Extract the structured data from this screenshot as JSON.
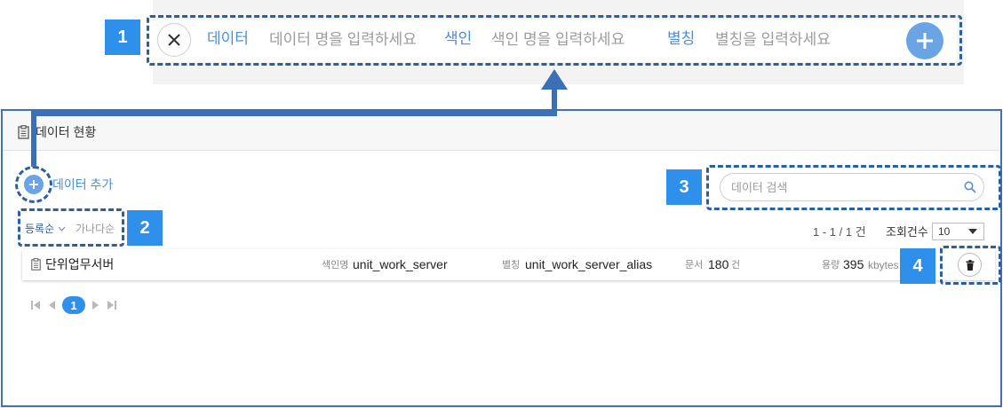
{
  "top_bar": {
    "fields": {
      "data": {
        "label": "데이터",
        "placeholder": "데이터 명을 입력하세요"
      },
      "index": {
        "label": "색인",
        "placeholder": "색인 명을 입력하세요"
      },
      "alias": {
        "label": "별칭",
        "placeholder": "별칭을 입력하세요"
      }
    },
    "icons": {
      "close": "close-icon",
      "add": "plus-icon"
    }
  },
  "callouts": {
    "c1": "1",
    "c2": "2",
    "c3": "3",
    "c4": "4"
  },
  "panel": {
    "title": "데이터 현황",
    "title_icon": "clipboard-icon",
    "add_label": "데이터 추가",
    "add_icon": "plus-icon",
    "search": {
      "placeholder": "데이터 검색",
      "icon": "search-icon"
    },
    "sort": {
      "selected": "등록순",
      "selected_icon": "chevron-down-icon",
      "other": "가나다순"
    },
    "result_range": "1 - 1 / 1 건",
    "page_size": {
      "label": "조회건수",
      "value": "10",
      "icon": "caret-down-icon"
    },
    "rows": [
      {
        "icon": "clipboard-icon",
        "name": "단위업무서버",
        "index_label": "색인명",
        "index_value": "unit_work_server",
        "alias_label": "별칭",
        "alias_value": "unit_work_server_alias",
        "doc_label": "문서",
        "doc_value": "180",
        "doc_unit": "건",
        "size_label": "용량",
        "size_value": "395",
        "size_unit": "kbytes",
        "action_icon": "trash-icon"
      }
    ],
    "pagination": {
      "current": "1",
      "icons": [
        "first-page-icon",
        "prev-page-icon",
        "next-page-icon",
        "last-page-icon"
      ]
    }
  },
  "colors": {
    "accent": "#4a90d9",
    "callout_badge": "#2f90ec",
    "callout_border": "#2c5f9e",
    "arrow": "#3b6fb6",
    "panel_border": "#3d72b8",
    "add_button": "#6aa4e4"
  }
}
